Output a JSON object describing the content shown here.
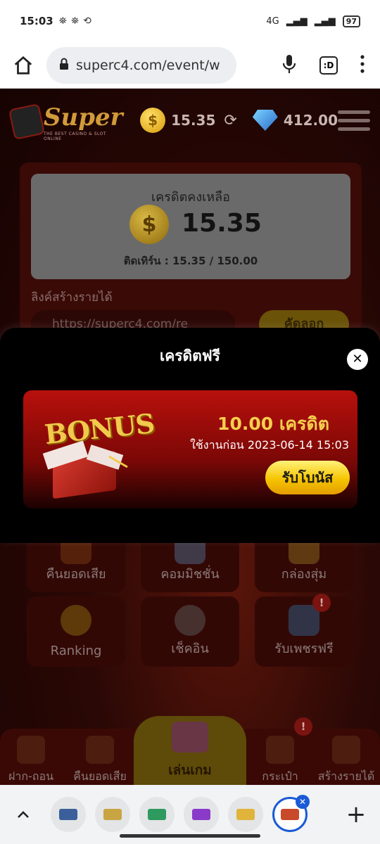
{
  "status": {
    "time": "15:03",
    "network": "4G",
    "battery": "97"
  },
  "browser": {
    "url": "superc4.com/event/w",
    "tab_label": ":D"
  },
  "site": {
    "logo_text": "Super",
    "logo_sub": "THE BEST CASINO & SLOT ONLINE",
    "coin_balance": "15.35",
    "diamond_balance": "412.00"
  },
  "credit": {
    "title": "เครดิตคงเหลือ",
    "value": "15.35",
    "turnover": "ติดเทิร์น : 15.35 / 150.00",
    "referral_label": "ลิงค์สร้างรายได้",
    "referral_link": "https://superc4.com/re",
    "copy_label": "คัดลอก"
  },
  "tiles": [
    {
      "label": "คืนยอดเสีย"
    },
    {
      "label": "คอมมิชชั่น"
    },
    {
      "label": "กล่องสุ่ม"
    },
    {
      "label": "Ranking"
    },
    {
      "label": "เช็คอิน"
    },
    {
      "label": "รับเพชรฟรี",
      "badge": "!"
    }
  ],
  "bottom_nav": {
    "items": [
      "ฝาก-ถอน",
      "คืนยอดเสีย",
      "เล่นเกม",
      "กระเป๋า",
      "สร้างรายได้"
    ],
    "wallet_badge": "!"
  },
  "modal": {
    "title": "เครดิตฟรี",
    "bonus_word": "BONUS",
    "amount": "10.00 เครดิต",
    "expire": "ใช้งานก่อน 2023-06-14 15:03",
    "claim_label": "รับโบนัส"
  },
  "colors": {
    "accent_gold": "#f6cf4c",
    "claim_button": "#f6c400",
    "bonus_red": "#b8100c",
    "active_tab": "#1a5ad6"
  }
}
